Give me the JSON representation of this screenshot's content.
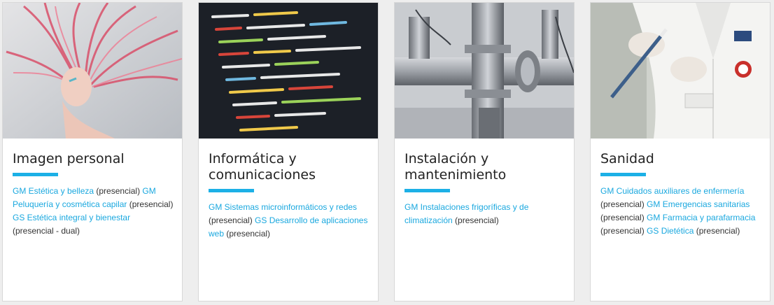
{
  "cards": [
    {
      "title": "Imagen personal",
      "image": "woman-pink-hair-photo",
      "entries": [
        {
          "link": "GM Estética y belleza",
          "mode": " (presencial) "
        },
        {
          "link": "GM Peluquería y cosmética capilar",
          "mode": " (presencial) "
        },
        {
          "link": "GS Estética integral y bienestar",
          "mode": " (presencial - dual)"
        }
      ]
    },
    {
      "title": "Informática y comunicaciones",
      "image": "source-code-screen-photo",
      "entries": [
        {
          "link": "GM Sistemas microinformáticos y redes",
          "mode": " (presencial) "
        },
        {
          "link": "GS Desarrollo de aplicaciones web",
          "mode": " (presencial)"
        }
      ]
    },
    {
      "title": "Instalación y mantenimiento",
      "image": "steel-pipes-machinery-photo",
      "entries": [
        {
          "link": "GM Instalaciones frigoríficas y de climatización",
          "mode": " (presencial)"
        }
      ]
    },
    {
      "title": "Sanidad",
      "image": "lab-technician-pipette-photo",
      "entries": [
        {
          "link": "GM Cuidados auxiliares de enfermería",
          "mode": " (presencial) "
        },
        {
          "link": "GM Emergencias sanitarias",
          "mode": " (presencial) "
        },
        {
          "link": "GM Farmacia y parafarmacia",
          "mode": " (presencial) "
        },
        {
          "link": "GS Dietética",
          "mode": " (presencial)"
        }
      ]
    }
  ],
  "colors": {
    "accent": "#1cb0e6",
    "link": "#1aa8df",
    "text": "#333333"
  }
}
